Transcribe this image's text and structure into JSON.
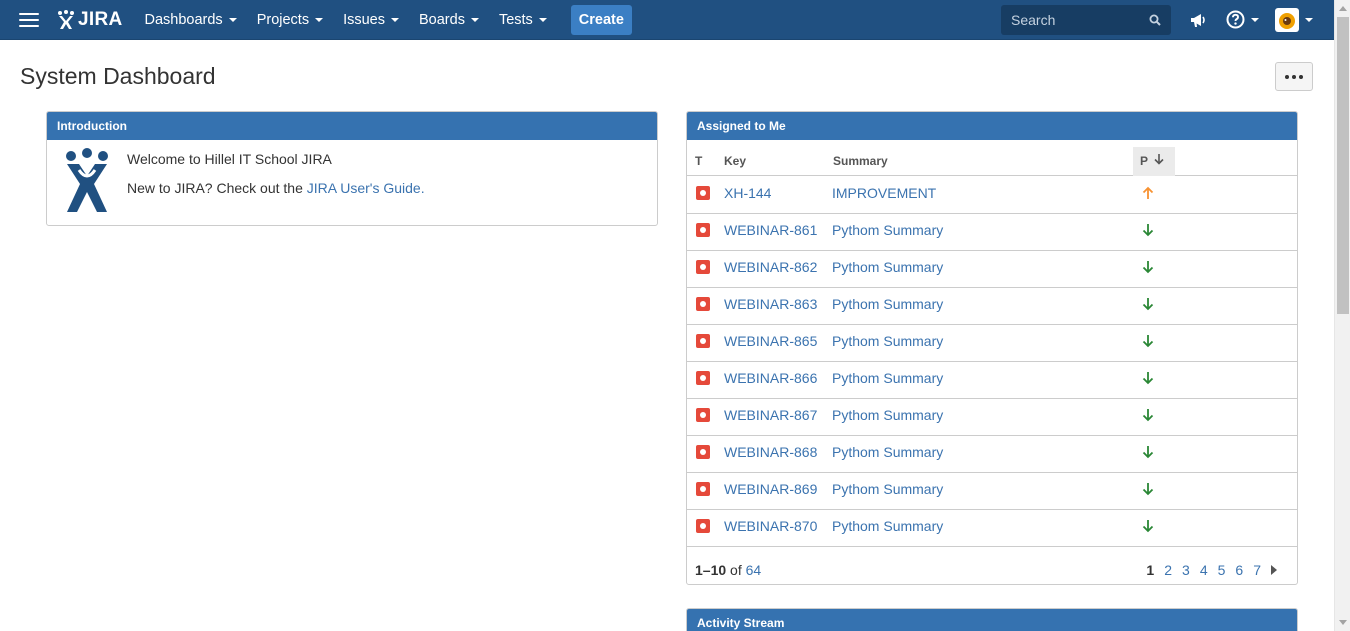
{
  "header": {
    "logo_text": "JIRA",
    "nav": [
      {
        "label": "Dashboards"
      },
      {
        "label": "Projects"
      },
      {
        "label": "Issues"
      },
      {
        "label": "Boards"
      },
      {
        "label": "Tests"
      }
    ],
    "create_label": "Create",
    "search_placeholder": "Search",
    "icons": [
      "menu-icon",
      "jira-logo-icon",
      "search-icon",
      "megaphone-icon",
      "help-icon",
      "user-avatar-icon"
    ],
    "colors": {
      "bar": "#205081",
      "create": "#3b7fc4",
      "search_bg": "#173d63"
    }
  },
  "page": {
    "title": "System Dashboard",
    "more_label": "•••"
  },
  "introduction": {
    "title": "Introduction",
    "welcome": "Welcome to Hillel IT School JIRA",
    "new_text": "New to JIRA? Check out the ",
    "guide_link": "JIRA User's Guide",
    "guide_suffix": "."
  },
  "assigned": {
    "title": "Assigned to Me",
    "columns": {
      "type": "T",
      "key": "Key",
      "summary": "Summary",
      "priority": "P"
    },
    "rows": [
      {
        "key": "XH-144",
        "summary": "IMPROVEMENT",
        "priority": "high"
      },
      {
        "key": "WEBINAR-861",
        "summary": "Pythom Summary",
        "priority": "low"
      },
      {
        "key": "WEBINAR-862",
        "summary": "Pythom Summary",
        "priority": "low"
      },
      {
        "key": "WEBINAR-863",
        "summary": "Pythom Summary",
        "priority": "low"
      },
      {
        "key": "WEBINAR-865",
        "summary": "Pythom Summary",
        "priority": "low"
      },
      {
        "key": "WEBINAR-866",
        "summary": "Pythom Summary",
        "priority": "low"
      },
      {
        "key": "WEBINAR-867",
        "summary": "Pythom Summary",
        "priority": "low"
      },
      {
        "key": "WEBINAR-868",
        "summary": "Pythom Summary",
        "priority": "low"
      },
      {
        "key": "WEBINAR-869",
        "summary": "Pythom Summary",
        "priority": "low"
      },
      {
        "key": "WEBINAR-870",
        "summary": "Pythom Summary",
        "priority": "low"
      }
    ],
    "range": "1–10",
    "of": " of ",
    "total": "64",
    "pages": [
      "1",
      "2",
      "3",
      "4",
      "5",
      "6",
      "7"
    ],
    "current_page": "1",
    "colors": {
      "bug": "#e5493a",
      "high_priority": "#f79232",
      "low_priority": "#2a8735"
    }
  },
  "activity": {
    "title": "Activity Stream"
  }
}
